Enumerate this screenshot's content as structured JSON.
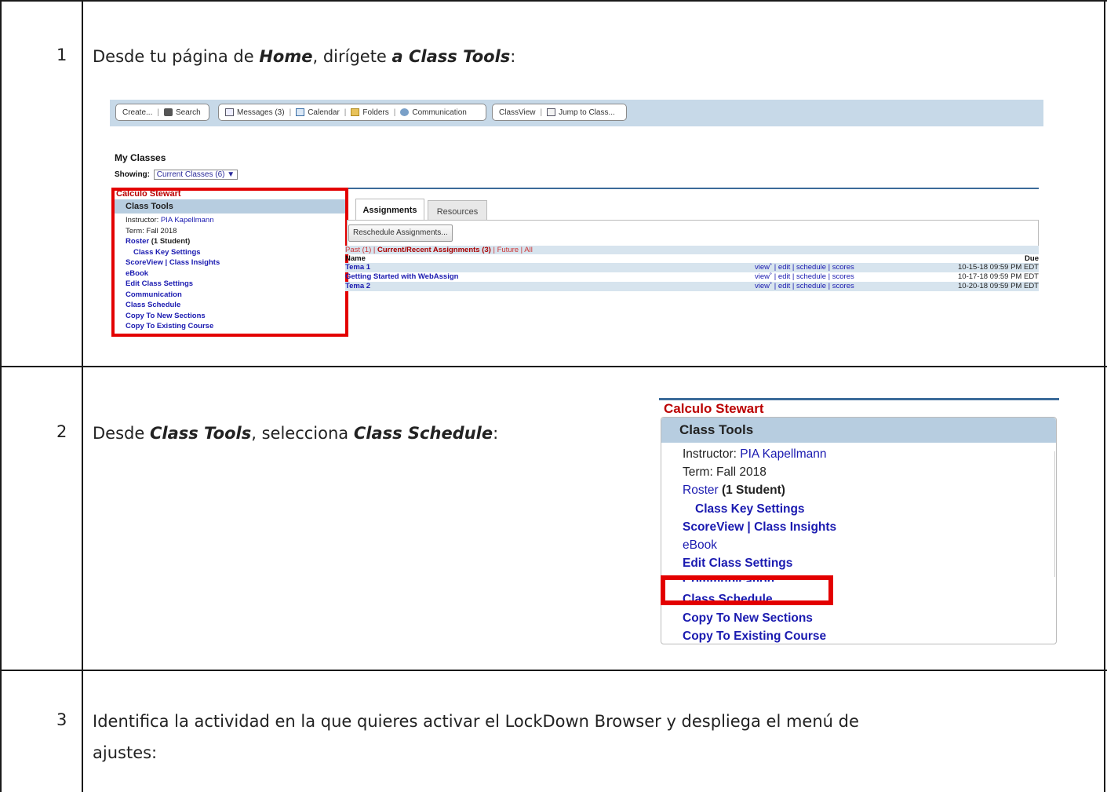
{
  "steps": [
    {
      "num": "1",
      "pre": "Desde tu página de ",
      "em1": "Home",
      "mid": ", dirígete ",
      "em2": "a Class Tools",
      "post": ":"
    },
    {
      "num": "2",
      "pre": "Desde ",
      "em1": "Class Tools",
      "mid": ", selecciona ",
      "em2": "Class Schedule",
      "post": ":"
    },
    {
      "num": "3",
      "line1": "Identifica la actividad en la que quieres activar el LockDown Browser y despliega el menú de",
      "line2": "ajustes:"
    }
  ],
  "toolbar": {
    "create": "Create...",
    "search": "Search",
    "messages": "Messages (3)",
    "calendar": "Calendar",
    "folders": "Folders",
    "communication": "Communication",
    "classview": "ClassView",
    "jump": "Jump to Class..."
  },
  "my_classes": {
    "title": "My Classes",
    "showing_label": "Showing:",
    "showing_value": "Current Classes (6) ▼"
  },
  "class": {
    "name": "Calculo Stewart",
    "tools_title": "Class Tools",
    "instructor_label": "Instructor:",
    "instructor_name": "PIA Kapellmann",
    "term": "Term: Fall 2018",
    "roster": "Roster",
    "roster_count": "(1 Student)",
    "class_key": "Class Key Settings",
    "scoreview": "ScoreView | Class Insights",
    "ebook": "eBook",
    "edit_settings": "Edit Class Settings",
    "communication": "Communication",
    "schedule": "Class Schedule",
    "copy_new": "Copy To New Sections",
    "copy_existing": "Copy To Existing Course"
  },
  "assignments": {
    "tab_assignments": "Assignments",
    "tab_resources": "Resources",
    "reschedule": "Reschedule Assignments...",
    "filter_past": "Past (1) | ",
    "filter_current": "Current/Recent Assignments (3)",
    "filter_rest": " | Future | All",
    "col_name": "Name",
    "col_due": "Due",
    "rows": [
      {
        "name": "Tema 1",
        "actions": "view˚ | edit | schedule | scores",
        "due": "10-15-18 09:59 PM EDT"
      },
      {
        "name": "Getting Started with WebAssign",
        "actions": "view˚ | edit | schedule | scores",
        "due": "10-17-18 09:59 PM EDT"
      },
      {
        "name": "Tema 2",
        "actions": "view˚ | edit | schedule | scores",
        "due": "10-20-18 09:59 PM EDT"
      }
    ]
  }
}
